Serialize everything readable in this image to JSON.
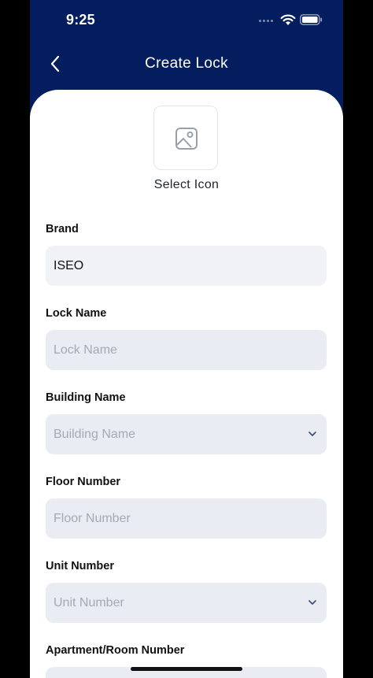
{
  "status_bar": {
    "time": "9:25"
  },
  "nav": {
    "title": "Create Lock"
  },
  "icon_picker": {
    "label": "Select Icon"
  },
  "form": {
    "brand": {
      "label": "Brand",
      "value": "ISEO"
    },
    "lock_name": {
      "label": "Lock Name",
      "placeholder": "Lock Name"
    },
    "building_name": {
      "label": "Building Name",
      "placeholder": "Building Name"
    },
    "floor_number": {
      "label": "Floor Number",
      "placeholder": "Floor Number"
    },
    "unit_number": {
      "label": "Unit Number",
      "placeholder": "Unit Number"
    },
    "apartment_room_number": {
      "label": "Apartment/Room Number"
    }
  },
  "colors": {
    "header_bg": "#031D5E",
    "field_bg": "#E9ECF2",
    "placeholder": "#A3A9B6",
    "chevron": "#3A4A72"
  },
  "icons": [
    "back-chevron-icon",
    "wifi-icon",
    "battery-icon",
    "image-icon",
    "chevron-down-icon"
  ]
}
